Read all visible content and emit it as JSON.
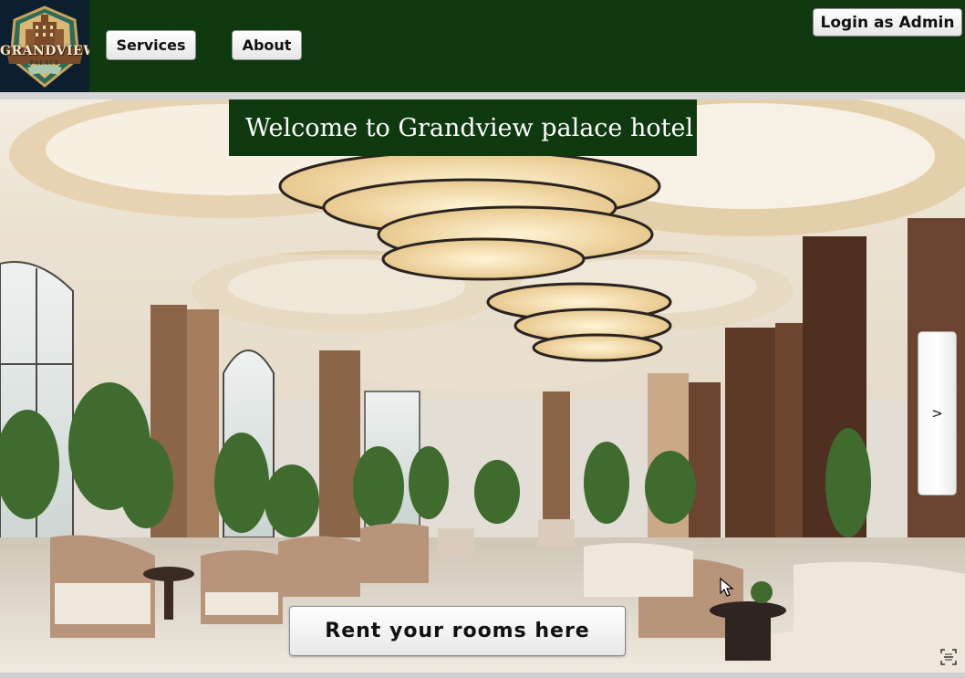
{
  "header": {
    "logo": {
      "title": "GRANDVIEW",
      "subtitle": "PALACE"
    },
    "nav": {
      "services_label": "Services",
      "about_label": "About"
    },
    "admin_login_label": "Login as Admin"
  },
  "hero": {
    "welcome_text": "Welcome to Grandview palace hotel",
    "next_label": ">",
    "rent_label": "Rent your rooms here"
  },
  "colors": {
    "header_bg": "#0f3a0f",
    "logo_bg": "#0b1f2e",
    "button_bg": "#f2f2f2"
  },
  "icons": [
    "hotel-logo-icon",
    "next-arrow-icon",
    "scan-icon",
    "mouse-cursor-icon"
  ]
}
